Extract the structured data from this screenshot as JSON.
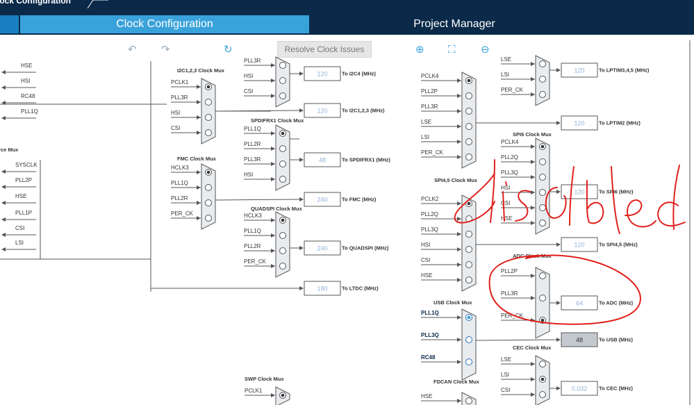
{
  "window": {
    "crumb": "lock Configuration"
  },
  "tabs": {
    "clock": "Clock Configuration",
    "project": "Project Manager"
  },
  "toolbar": {
    "resolve": "Resolve Clock Issues",
    "undo_icon": "undo-icon",
    "redo_icon": "redo-icon",
    "refresh_icon": "refresh-icon",
    "zoom_in_icon": "zoom-in-icon",
    "fit_icon": "fit-icon",
    "zoom_out_icon": "zoom-out-icon"
  },
  "left_labels": {
    "a": [
      "HSE",
      "HSI",
      "RC48",
      "PLL1Q"
    ],
    "title": "rce Mux",
    "b": [
      "SYSCLK",
      "PLL2P",
      "HSE",
      "PLL1P",
      "CSI",
      "LSI"
    ]
  },
  "muxes": [
    {
      "title": "I2C1,2,3 Clock Mux",
      "inputs": [
        "PCLK1",
        "PLL3R",
        "HSI",
        "CSI"
      ],
      "sel": 0
    },
    {
      "title": "FMC Clock Mux",
      "inputs": [
        "HCLK3",
        "PLL1Q",
        "PLL2R",
        "PER_CK"
      ],
      "sel": 0
    },
    {
      "title": "",
      "inputs": [
        "PLL3R",
        "HSI",
        "CSI"
      ],
      "sel": -1
    },
    {
      "title": "SPDIFRX1 Clock Mux",
      "inputs": [
        "PLL1Q",
        "PLL2R",
        "PLL3R",
        "HSI"
      ],
      "sel": 0
    },
    {
      "title": "QUADSPI Clock Mux",
      "inputs": [
        "HCLK3",
        "PLL1Q",
        "PLL2R",
        "PER_CK"
      ],
      "sel": 0
    },
    {
      "title": "SWP Clock Mux",
      "inputs": [
        "PCLK1"
      ],
      "sel": 0
    },
    {
      "title": "",
      "inputs": [
        "PCLK4",
        "PLL2P",
        "PLL3R",
        "LSE",
        "LSI",
        "PER_CK"
      ],
      "sel": 0
    },
    {
      "title": "SPI4,5 Clock Mux",
      "inputs": [
        "PCLK2",
        "PLL2Q",
        "PLL3Q",
        "HSI",
        "CSI",
        "HSE"
      ],
      "sel": 0
    },
    {
      "title": "USB Clock Mux",
      "inputs": [
        "PLL1Q",
        "PLL3Q",
        "RC48"
      ],
      "sel": 0
    },
    {
      "title": "FDCAN Clock Mux",
      "inputs": [
        "HSE"
      ],
      "sel": -1
    },
    {
      "title": "",
      "inputs": [
        "LSE",
        "LSI",
        "PER_CK"
      ],
      "sel": -1
    },
    {
      "title": "SPI6 Clock Mux",
      "inputs": [
        "PCLK4",
        "PLL2Q",
        "PLL3Q",
        "HSI",
        "CSI",
        "HSE"
      ],
      "sel": 0
    },
    {
      "title": "ADC Clock Mux",
      "inputs": [
        "PLL2P",
        "PLL3R",
        "PER_CK"
      ],
      "sel": 2
    },
    {
      "title": "CEC Clock Mux",
      "inputs": [
        "LSE",
        "LSI",
        "CSI"
      ],
      "sel": 1
    }
  ],
  "outputs": [
    {
      "value": "120",
      "label": "To I2C4 (MHz)"
    },
    {
      "value": "120",
      "label": "To I2C1,2,3 (MHz)"
    },
    {
      "value": "48",
      "label": "To SPDIFRX1 (MHz)"
    },
    {
      "value": "240",
      "label": "To FMC (MHz)"
    },
    {
      "value": "240",
      "label": "To QUADSPI (MHz)"
    },
    {
      "value": "180",
      "label": "To LTDC (MHz)"
    },
    {
      "value": "120",
      "label": "To LPTIM3,4,5 (MHz)"
    },
    {
      "value": "120",
      "label": "To LPTIM2 (MHz)"
    },
    {
      "value": "120",
      "label": "To SPI6 (MHz)"
    },
    {
      "value": "120",
      "label": "To SPI4,5 (MHz)"
    },
    {
      "value": "64",
      "label": "To ADC (MHz)"
    },
    {
      "value": "48",
      "label": "To USB (MHz)"
    },
    {
      "value": "0.032",
      "label": "To CEC (MHz)"
    }
  ],
  "annotation": {
    "text": "disabled",
    "color": "#e0201c"
  },
  "colors": {
    "navy": "#0b2a4a",
    "tab_active": "#3aa2da",
    "mux_fill": "#e9ecef",
    "value_text": "#8fb3d6"
  }
}
